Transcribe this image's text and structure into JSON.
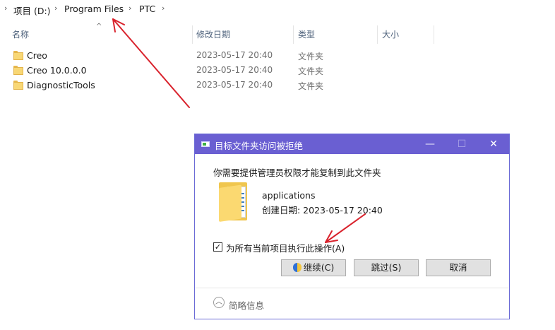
{
  "breadcrumb": {
    "parts": [
      "项目 (D:)",
      "Program Files",
      "PTC"
    ],
    "separator": "›"
  },
  "file_list": {
    "columns": [
      "名称",
      "修改日期",
      "类型",
      "大小"
    ],
    "sort_indicator": "^",
    "rows": [
      {
        "name": "Creo",
        "date": "2023-05-17 20:40",
        "type": "文件夹"
      },
      {
        "name": "Creo 10.0.0.0",
        "date": "2023-05-17 20:40",
        "type": "文件夹"
      },
      {
        "name": "DiagnosticTools",
        "date": "2023-05-17 20:40",
        "type": "文件夹"
      }
    ]
  },
  "dialog": {
    "title": "目标文件夹访问被拒绝",
    "minimize_glyph": "—",
    "maximize_glyph": "☐",
    "close_glyph": "✕",
    "message": "你需要提供管理员权限才能复制到此文件夹",
    "file_name": "applications",
    "file_date": "创建日期: 2023-05-17 20:40",
    "checkbox_label": "为所有当前项目执行此操作(A)",
    "checkbox_checked": true,
    "checkbox_glyph": "✓",
    "buttons": {
      "continue": "继续(C)",
      "skip": "跳过(S)",
      "cancel": "取消"
    },
    "collapse_glyph": "︿",
    "collapse_label": "简略信息"
  },
  "colors": {
    "dialog_titlebar": "#6a5fd2",
    "annotation_arrow": "#d9232d",
    "folder_yellow": "#f8d775"
  },
  "icons": [
    "folder-icon",
    "app-icon",
    "shield-icon",
    "chevron-up-icon",
    "check-icon"
  ]
}
